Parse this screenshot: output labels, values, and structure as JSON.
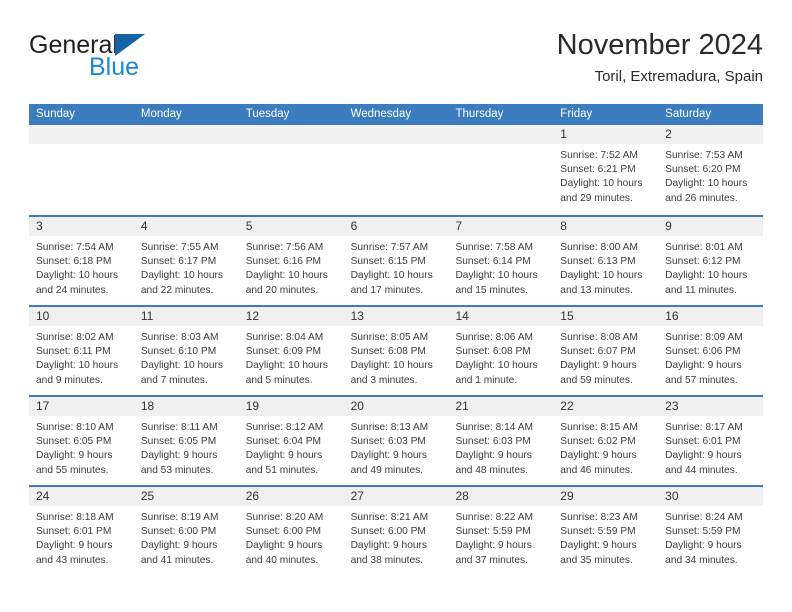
{
  "brand": {
    "name_part1": "General",
    "name_part2": "Blue",
    "mark": "triangle-logo"
  },
  "header": {
    "month_title": "November 2024",
    "location": "Toril, Extremadura, Spain"
  },
  "colors": {
    "header_blue": "#3a7cbe",
    "brand_blue": "#1a87d6",
    "mark_blue": "#1464a5",
    "day_band_gray": "#f0f0f0",
    "text": "#333333"
  },
  "weekdays": [
    "Sunday",
    "Monday",
    "Tuesday",
    "Wednesday",
    "Thursday",
    "Friday",
    "Saturday"
  ],
  "weeks": [
    [
      {
        "day": "",
        "empty": true
      },
      {
        "day": "",
        "empty": true
      },
      {
        "day": "",
        "empty": true
      },
      {
        "day": "",
        "empty": true
      },
      {
        "day": "",
        "empty": true
      },
      {
        "day": "1",
        "sunrise": "Sunrise: 7:52 AM",
        "sunset": "Sunset: 6:21 PM",
        "daylight": "Daylight: 10 hours and 29 minutes."
      },
      {
        "day": "2",
        "sunrise": "Sunrise: 7:53 AM",
        "sunset": "Sunset: 6:20 PM",
        "daylight": "Daylight: 10 hours and 26 minutes."
      }
    ],
    [
      {
        "day": "3",
        "sunrise": "Sunrise: 7:54 AM",
        "sunset": "Sunset: 6:18 PM",
        "daylight": "Daylight: 10 hours and 24 minutes."
      },
      {
        "day": "4",
        "sunrise": "Sunrise: 7:55 AM",
        "sunset": "Sunset: 6:17 PM",
        "daylight": "Daylight: 10 hours and 22 minutes."
      },
      {
        "day": "5",
        "sunrise": "Sunrise: 7:56 AM",
        "sunset": "Sunset: 6:16 PM",
        "daylight": "Daylight: 10 hours and 20 minutes."
      },
      {
        "day": "6",
        "sunrise": "Sunrise: 7:57 AM",
        "sunset": "Sunset: 6:15 PM",
        "daylight": "Daylight: 10 hours and 17 minutes."
      },
      {
        "day": "7",
        "sunrise": "Sunrise: 7:58 AM",
        "sunset": "Sunset: 6:14 PM",
        "daylight": "Daylight: 10 hours and 15 minutes."
      },
      {
        "day": "8",
        "sunrise": "Sunrise: 8:00 AM",
        "sunset": "Sunset: 6:13 PM",
        "daylight": "Daylight: 10 hours and 13 minutes."
      },
      {
        "day": "9",
        "sunrise": "Sunrise: 8:01 AM",
        "sunset": "Sunset: 6:12 PM",
        "daylight": "Daylight: 10 hours and 11 minutes."
      }
    ],
    [
      {
        "day": "10",
        "sunrise": "Sunrise: 8:02 AM",
        "sunset": "Sunset: 6:11 PM",
        "daylight": "Daylight: 10 hours and 9 minutes."
      },
      {
        "day": "11",
        "sunrise": "Sunrise: 8:03 AM",
        "sunset": "Sunset: 6:10 PM",
        "daylight": "Daylight: 10 hours and 7 minutes."
      },
      {
        "day": "12",
        "sunrise": "Sunrise: 8:04 AM",
        "sunset": "Sunset: 6:09 PM",
        "daylight": "Daylight: 10 hours and 5 minutes."
      },
      {
        "day": "13",
        "sunrise": "Sunrise: 8:05 AM",
        "sunset": "Sunset: 6:08 PM",
        "daylight": "Daylight: 10 hours and 3 minutes."
      },
      {
        "day": "14",
        "sunrise": "Sunrise: 8:06 AM",
        "sunset": "Sunset: 6:08 PM",
        "daylight": "Daylight: 10 hours and 1 minute."
      },
      {
        "day": "15",
        "sunrise": "Sunrise: 8:08 AM",
        "sunset": "Sunset: 6:07 PM",
        "daylight": "Daylight: 9 hours and 59 minutes."
      },
      {
        "day": "16",
        "sunrise": "Sunrise: 8:09 AM",
        "sunset": "Sunset: 6:06 PM",
        "daylight": "Daylight: 9 hours and 57 minutes."
      }
    ],
    [
      {
        "day": "17",
        "sunrise": "Sunrise: 8:10 AM",
        "sunset": "Sunset: 6:05 PM",
        "daylight": "Daylight: 9 hours and 55 minutes."
      },
      {
        "day": "18",
        "sunrise": "Sunrise: 8:11 AM",
        "sunset": "Sunset: 6:05 PM",
        "daylight": "Daylight: 9 hours and 53 minutes."
      },
      {
        "day": "19",
        "sunrise": "Sunrise: 8:12 AM",
        "sunset": "Sunset: 6:04 PM",
        "daylight": "Daylight: 9 hours and 51 minutes."
      },
      {
        "day": "20",
        "sunrise": "Sunrise: 8:13 AM",
        "sunset": "Sunset: 6:03 PM",
        "daylight": "Daylight: 9 hours and 49 minutes."
      },
      {
        "day": "21",
        "sunrise": "Sunrise: 8:14 AM",
        "sunset": "Sunset: 6:03 PM",
        "daylight": "Daylight: 9 hours and 48 minutes."
      },
      {
        "day": "22",
        "sunrise": "Sunrise: 8:15 AM",
        "sunset": "Sunset: 6:02 PM",
        "daylight": "Daylight: 9 hours and 46 minutes."
      },
      {
        "day": "23",
        "sunrise": "Sunrise: 8:17 AM",
        "sunset": "Sunset: 6:01 PM",
        "daylight": "Daylight: 9 hours and 44 minutes."
      }
    ],
    [
      {
        "day": "24",
        "sunrise": "Sunrise: 8:18 AM",
        "sunset": "Sunset: 6:01 PM",
        "daylight": "Daylight: 9 hours and 43 minutes."
      },
      {
        "day": "25",
        "sunrise": "Sunrise: 8:19 AM",
        "sunset": "Sunset: 6:00 PM",
        "daylight": "Daylight: 9 hours and 41 minutes."
      },
      {
        "day": "26",
        "sunrise": "Sunrise: 8:20 AM",
        "sunset": "Sunset: 6:00 PM",
        "daylight": "Daylight: 9 hours and 40 minutes."
      },
      {
        "day": "27",
        "sunrise": "Sunrise: 8:21 AM",
        "sunset": "Sunset: 6:00 PM",
        "daylight": "Daylight: 9 hours and 38 minutes."
      },
      {
        "day": "28",
        "sunrise": "Sunrise: 8:22 AM",
        "sunset": "Sunset: 5:59 PM",
        "daylight": "Daylight: 9 hours and 37 minutes."
      },
      {
        "day": "29",
        "sunrise": "Sunrise: 8:23 AM",
        "sunset": "Sunset: 5:59 PM",
        "daylight": "Daylight: 9 hours and 35 minutes."
      },
      {
        "day": "30",
        "sunrise": "Sunrise: 8:24 AM",
        "sunset": "Sunset: 5:59 PM",
        "daylight": "Daylight: 9 hours and 34 minutes."
      }
    ]
  ]
}
